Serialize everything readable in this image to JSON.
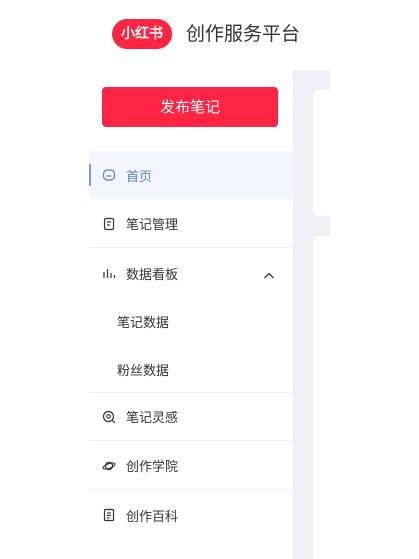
{
  "header": {
    "logo_text": "小红书",
    "platform_title": "创作服务平台"
  },
  "sidebar": {
    "publish_label": "发布笔记",
    "items": [
      {
        "label": "首页",
        "icon": "home-icon",
        "active": true
      },
      {
        "label": "笔记管理",
        "icon": "note-icon"
      },
      {
        "label": "数据看板",
        "icon": "chart-icon",
        "expanded": true,
        "children": [
          {
            "label": "笔记数据"
          },
          {
            "label": "粉丝数据"
          }
        ]
      },
      {
        "label": "笔记灵感",
        "icon": "inspiration-icon"
      },
      {
        "label": "创作学院",
        "icon": "planet-icon"
      },
      {
        "label": "创作百科",
        "icon": "book-icon"
      }
    ]
  },
  "colors": {
    "brand": "#ff2442",
    "active_text": "#5f7fbf",
    "active_bg": "#f3f6fd",
    "main_bg": "#eef0f6"
  }
}
